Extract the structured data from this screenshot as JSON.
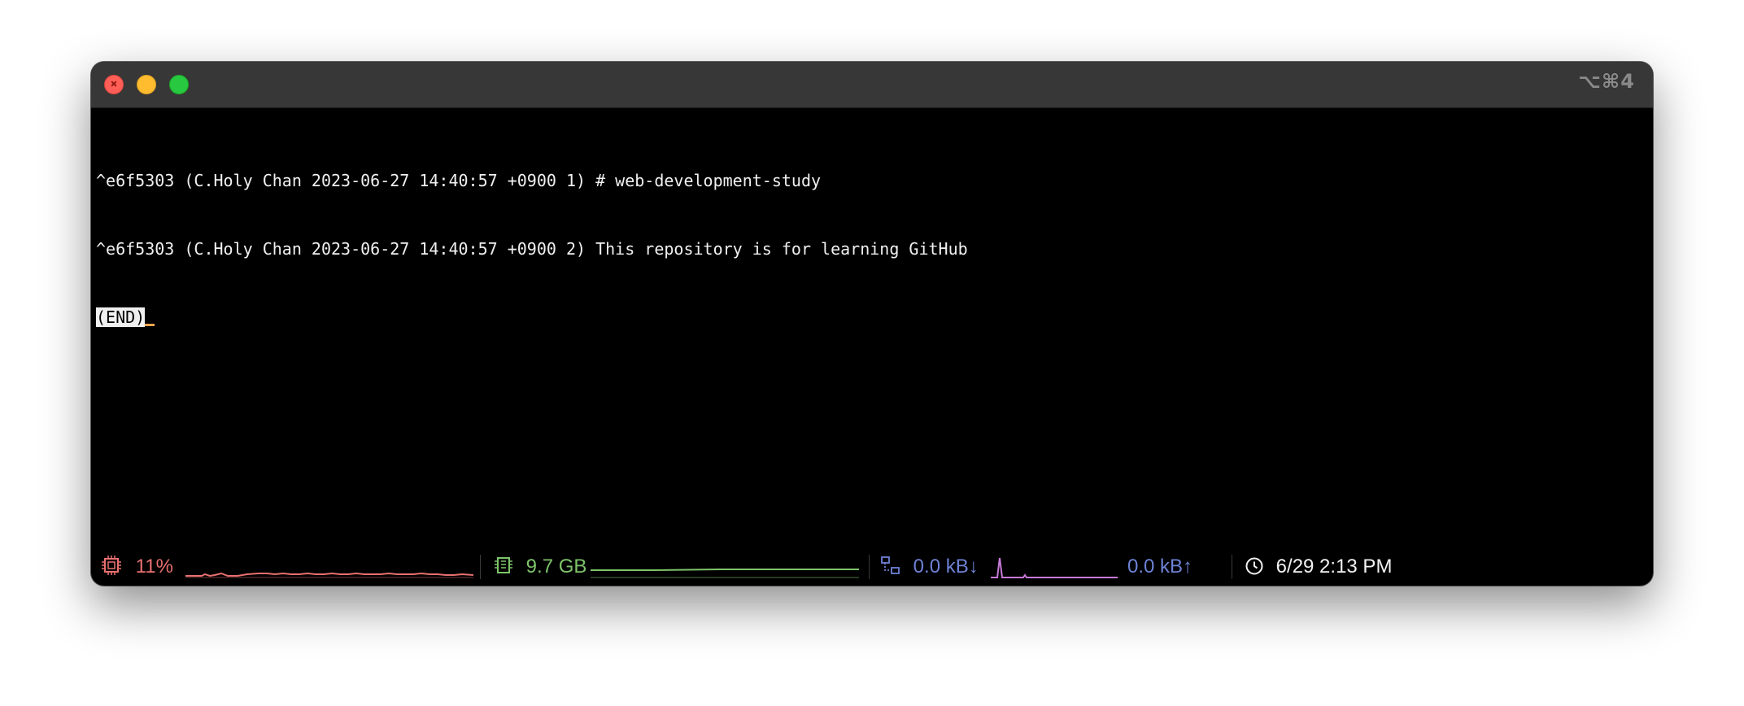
{
  "window": {
    "shortcut": "⌥⌘4"
  },
  "terminal": {
    "lines": [
      "^e6f5303 (C.Holy Chan 2023-06-27 14:40:57 +0900 1) # web-development-study",
      "^e6f5303 (C.Holy Chan 2023-06-27 14:40:57 +0900 2) This repository is for learning GitHub"
    ],
    "end_marker": "(END)"
  },
  "statusbar": {
    "cpu": {
      "icon": "cpu-icon",
      "value": "11%",
      "color": "#e97070"
    },
    "memory": {
      "icon": "memory-icon",
      "value": "9.7 GB",
      "color": "#7ec46a"
    },
    "network": {
      "icon": "network-icon",
      "download": "0.0 kB↓",
      "upload": "0.0 kB↑",
      "color": "#6e82d6",
      "graph_color": "#c77ad8"
    },
    "clock": {
      "icon": "clock-icon",
      "value": "6/29 2:13 PM",
      "color": "#f2f2f2"
    }
  }
}
